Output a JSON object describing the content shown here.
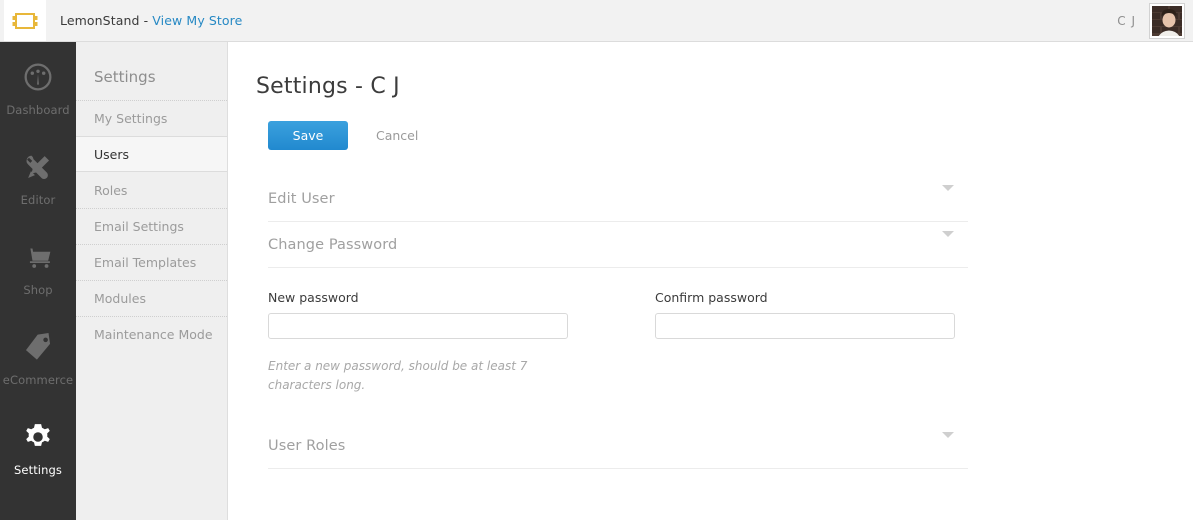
{
  "topbar": {
    "logo_icon": "lemon-logo-icon",
    "brand_text": "LemonStand - ",
    "store_link": "View My Store",
    "user_initials": "C J",
    "avatar_icon": "user-avatar",
    "logo_color": "#e8b73a",
    "link_color": "#2789c4"
  },
  "rail": {
    "items": [
      {
        "label": "Dashboard",
        "icon": "gauge-icon",
        "active": false
      },
      {
        "label": "Editor",
        "icon": "wrench-pencil-icon",
        "active": false
      },
      {
        "label": "Shop",
        "icon": "shopping-cart-icon",
        "active": false
      },
      {
        "label": "eCommerce",
        "icon": "price-tag-icon",
        "active": false
      },
      {
        "label": "Settings",
        "icon": "gear-icon",
        "active": true
      }
    ]
  },
  "submenu": {
    "title": "Settings",
    "items": [
      {
        "label": "My Settings",
        "active": false
      },
      {
        "label": "Users",
        "active": true
      },
      {
        "label": "Roles",
        "active": false
      },
      {
        "label": "Email Settings",
        "active": false
      },
      {
        "label": "Email Templates",
        "active": false
      },
      {
        "label": "Modules",
        "active": false
      },
      {
        "label": "Maintenance Mode",
        "active": false
      }
    ]
  },
  "main": {
    "page_title": "Settings - C J",
    "save_label": "Save",
    "cancel_label": "Cancel",
    "save_color": "#2189cf",
    "sections": {
      "edit_user": "Edit User",
      "change_password": "Change Password",
      "user_roles": "User Roles"
    },
    "password_form": {
      "new_password_label": "New password",
      "new_password_value": "",
      "new_password_placeholder": "",
      "confirm_password_label": "Confirm password",
      "confirm_password_value": "",
      "confirm_password_placeholder": "",
      "help_text": "Enter a new password, should be at least 7 characters long."
    }
  }
}
